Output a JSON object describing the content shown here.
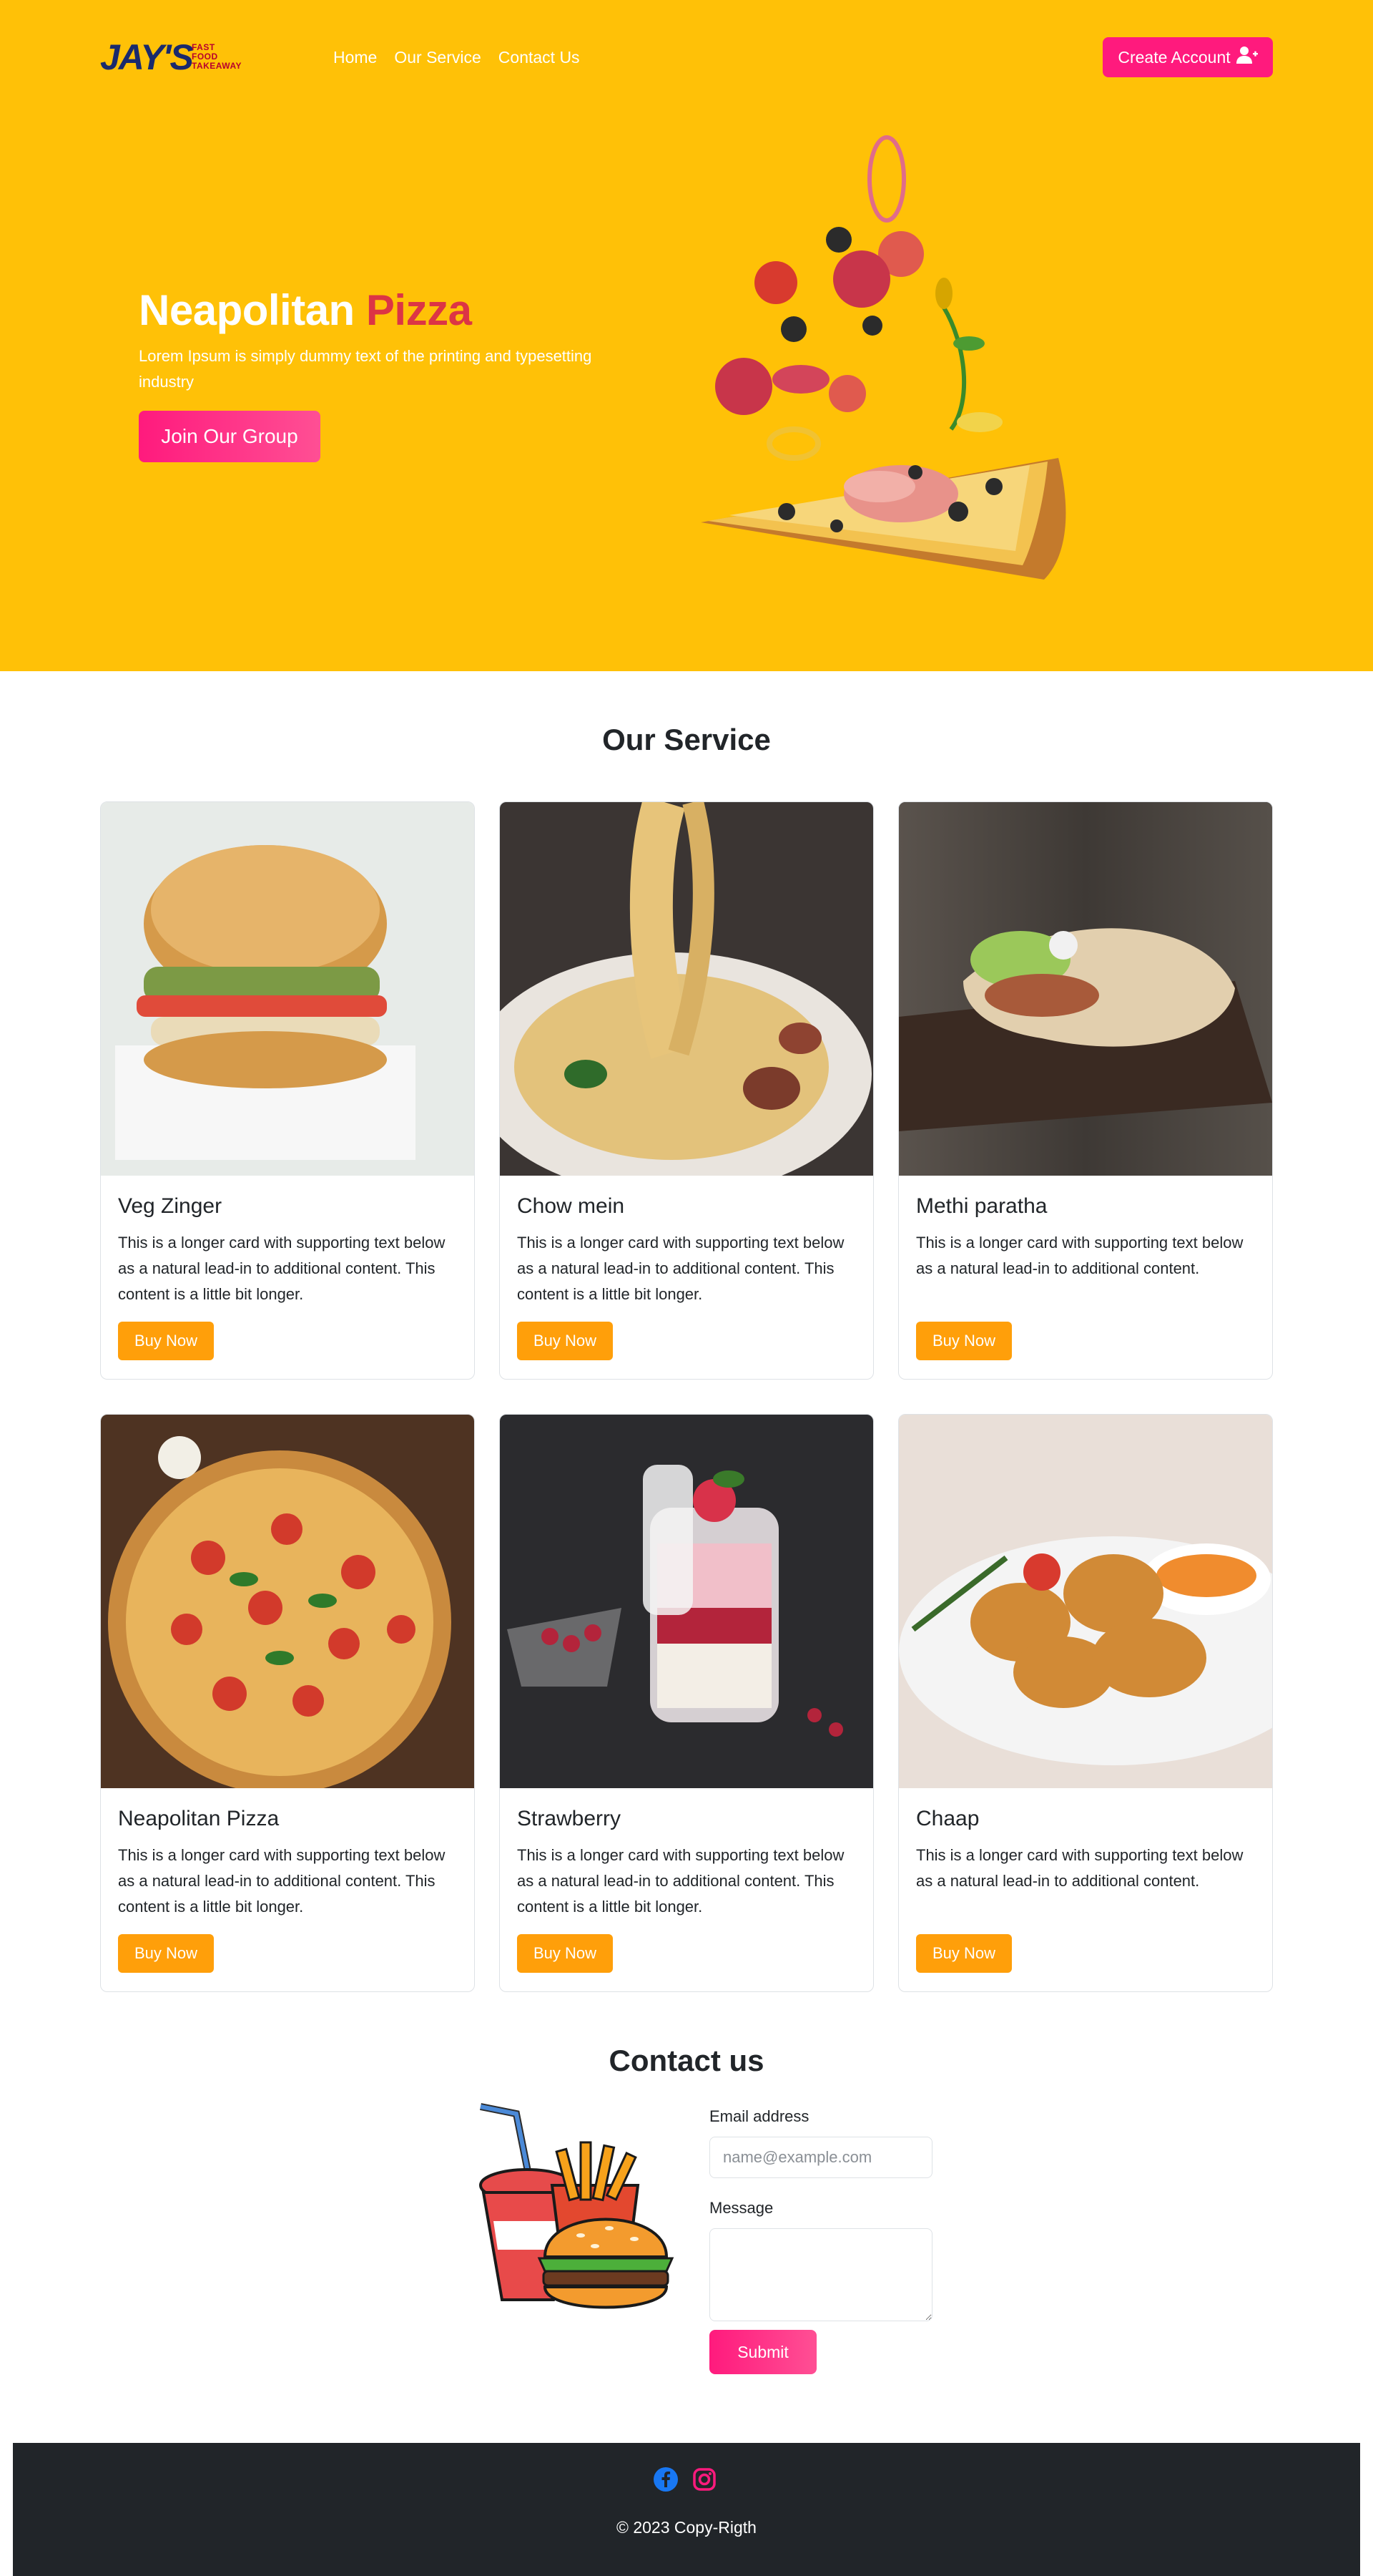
{
  "brand": {
    "logo_main": "JAY'S",
    "logo_sub": [
      "FAST",
      "FOOD",
      "TAKEAWAY"
    ]
  },
  "nav": {
    "links": [
      "Home",
      "Our Service",
      "Contact Us"
    ],
    "create_account": "Create Account",
    "create_account_icon": "user-plus-icon"
  },
  "hero": {
    "title_part1": "Neapolitan",
    "title_part2": "Pizza",
    "text": "Lorem Ipsum is simply dummy text of the printing and typesetting industry",
    "button": "Join Our Group",
    "image": "flying-pizza-slice"
  },
  "services": {
    "heading": "Our Service",
    "cards": [
      {
        "title": "Veg Zinger",
        "text": "This is a longer card with supporting text below as a natural lead-in to additional content. This content is a little bit longer.",
        "button": "Buy Now",
        "image": "burger-photo"
      },
      {
        "title": "Chow mein",
        "text": "This is a longer card with supporting text below as a natural lead-in to additional content. This content is a little bit longer.",
        "button": "Buy Now",
        "image": "noodles-photo"
      },
      {
        "title": "Methi paratha",
        "text": "This is a longer card with supporting text below as a natural lead-in to additional content.",
        "button": "Buy Now",
        "image": "pita-wrap-photo"
      },
      {
        "title": "Neapolitan Pizza",
        "text": "This is a longer card with supporting text below as a natural lead-in to additional content. This content is a little bit longer.",
        "button": "Buy Now",
        "image": "pizza-photo"
      },
      {
        "title": "Strawberry",
        "text": "This is a longer card with supporting text below as a natural lead-in to additional content. This content is a little bit longer.",
        "button": "Buy Now",
        "image": "dessert-jar-photo"
      },
      {
        "title": "Chaap",
        "text": "This is a longer card with supporting text below as a natural lead-in to additional content.",
        "button": "Buy Now",
        "image": "nuggets-photo"
      }
    ]
  },
  "contact": {
    "heading": "Contact us",
    "email_label": "Email address",
    "email_placeholder": "name@example.com",
    "message_label": "Message",
    "message_value": "",
    "submit": "Submit",
    "image": "fast-food-illustration"
  },
  "footer": {
    "icons": [
      "facebook-icon",
      "instagram-icon"
    ],
    "copyright": "© 2023 Copy-Rigth"
  },
  "colors": {
    "hero_bg": "#ffc107",
    "accent_pink": "#ff1a7d",
    "accent_red": "#dc3545",
    "buy_orange": "#ff9f0a",
    "footer_bg": "#212529"
  }
}
